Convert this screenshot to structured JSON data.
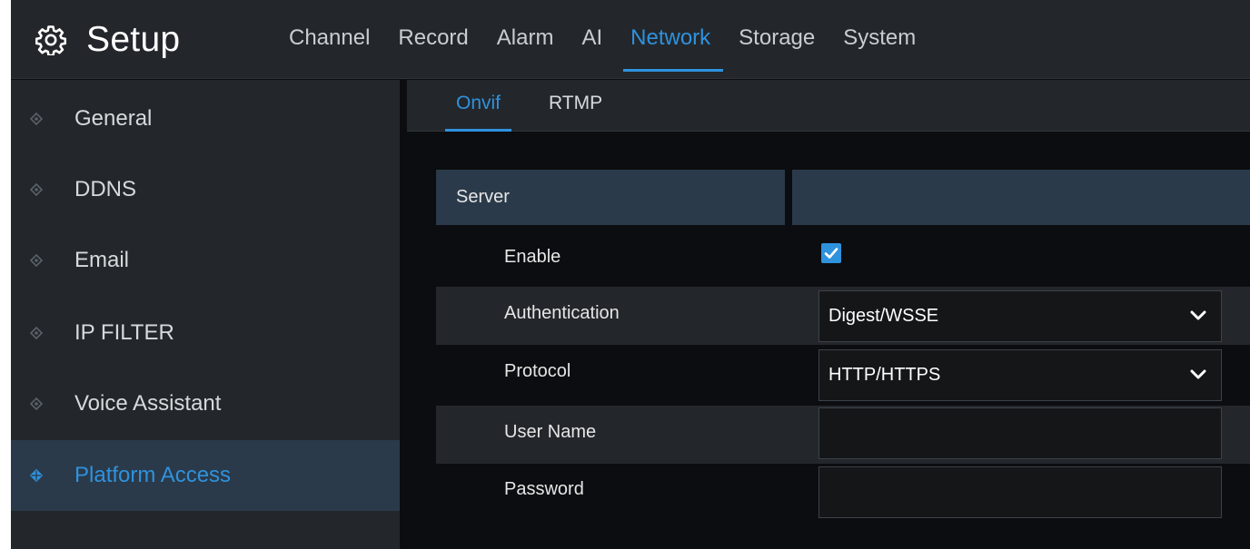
{
  "app": {
    "title": "Setup",
    "accent": "#2f92dd"
  },
  "header": {
    "tabs": [
      {
        "label": "Channel",
        "active": false
      },
      {
        "label": "Record",
        "active": false
      },
      {
        "label": "Alarm",
        "active": false
      },
      {
        "label": "AI",
        "active": false
      },
      {
        "label": "Network",
        "active": true
      },
      {
        "label": "Storage",
        "active": false
      },
      {
        "label": "System",
        "active": false
      }
    ]
  },
  "sidebar": {
    "items": [
      {
        "label": "General",
        "icon": "diamond-bullet-icon",
        "active": false
      },
      {
        "label": "DDNS",
        "icon": "diamond-bullet-icon",
        "active": false
      },
      {
        "label": "Email",
        "icon": "diamond-bullet-icon",
        "active": false
      },
      {
        "label": "IP FILTER",
        "icon": "diamond-bullet-icon",
        "active": false
      },
      {
        "label": "Voice Assistant",
        "icon": "diamond-bullet-icon",
        "active": false
      },
      {
        "label": "Platform Access",
        "icon": "diamond-bullet-icon",
        "active": true
      }
    ]
  },
  "subtabs": [
    {
      "label": "Onvif",
      "active": true
    },
    {
      "label": "RTMP",
      "active": false
    }
  ],
  "form": {
    "section": "Server",
    "enable": {
      "label": "Enable",
      "checked": true
    },
    "authentication": {
      "label": "Authentication",
      "value": "Digest/WSSE"
    },
    "protocol": {
      "label": "Protocol",
      "value": "HTTP/HTTPS"
    },
    "username": {
      "label": "User Name",
      "value": ""
    },
    "password": {
      "label": "Password",
      "value": ""
    }
  }
}
